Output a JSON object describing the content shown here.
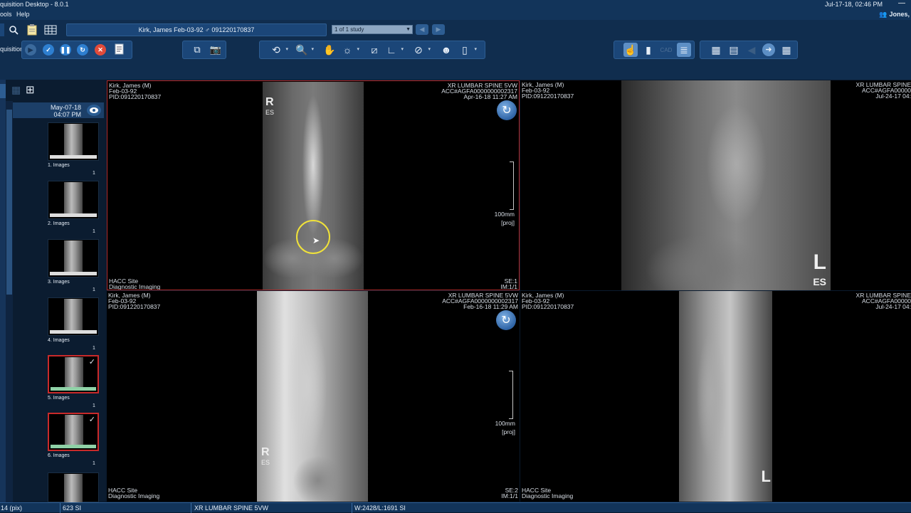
{
  "window": {
    "title": "quisition Desktop - 8.0.1",
    "datetime": "Jul-17-18, 02:46 PM",
    "user": "Jones,"
  },
  "menu": {
    "tools": "ools",
    "help": "Help"
  },
  "patient_bar": {
    "patient": "Kirk, James  Feb-03-92  ♂  091220170837",
    "study_select": "1 of 1 study"
  },
  "acquisition": {
    "label": "quisition"
  },
  "icons": {
    "search": "magnifier-icon",
    "clipboard": "clipboard-icon",
    "grid": "grid-icon",
    "play": "play-icon",
    "check": "check-icon",
    "pause": "pause-icon",
    "refresh": "refresh-icon",
    "stop": "stop-icon",
    "document": "document-icon"
  },
  "colors": {
    "accent_red": "#c92a2a",
    "panel_blue": "#1b4678",
    "thumb_green": "#8fd1a6"
  },
  "study": {
    "date": "May-07-18",
    "time": "04:07 PM"
  },
  "thumbnails": [
    {
      "label": "1.  Images",
      "count": "1",
      "selected": false
    },
    {
      "label": "2.  Images",
      "count": "1",
      "selected": false
    },
    {
      "label": "3.  Images",
      "count": "1",
      "selected": false
    },
    {
      "label": "4.  Images",
      "count": "1",
      "selected": false
    },
    {
      "label": "5.  Images",
      "count": "1",
      "selected": true
    },
    {
      "label": "6.  Images",
      "count": "1",
      "selected": true
    }
  ],
  "viewports": [
    {
      "patient": "Kirk, James (M)",
      "dob": "Feb-03-92",
      "pid": "PID:091220170837",
      "exam": "XR LUMBAR SPINE 5VW",
      "acc": "ACC#AGFA0000000002317",
      "datetime": "Apr-16-18 11:27 AM",
      "site": "HACC Site",
      "dept": "Diagnostic Imaging",
      "series": "SE:1",
      "image": "IM:1/1",
      "scale": "100mm",
      "proj": "[proj]",
      "marker": "R",
      "marker2": "ES"
    },
    {
      "patient": "Kirk, James (M)",
      "dob": "Feb-03-92",
      "pid": "PID:091220170837",
      "exam": "XR LUMBAR SPINE",
      "acc": "ACC#AGFA00000",
      "datetime": "Jul-24-17 04:",
      "marker": "L",
      "marker2": "ES"
    },
    {
      "patient": "Kirk, James (M)",
      "dob": "Feb-03-92",
      "pid": "PID:091220170837",
      "exam": "XR LUMBAR SPINE 5VW",
      "acc": "ACC#AGFA0000000002317",
      "datetime": "Feb-16-18 11:29 AM",
      "site": "HACC Site",
      "dept": "Diagnostic Imaging",
      "series": "SE:2",
      "image": "IM:1/1",
      "scale": "100mm",
      "proj": "[proj]",
      "marker": "R",
      "marker2": "ES"
    },
    {
      "patient": "Kirk, James (M)",
      "dob": "Feb-03-92",
      "pid": "PID:091220170837",
      "exam": "XR LUMBAR SPINE",
      "acc": "ACC#AGFA00000",
      "datetime": "Jul-24-17 04:",
      "site": "HACC Site",
      "dept": "Diagnostic Imaging",
      "marker": "L"
    }
  ],
  "statusbar": {
    "pix": "14 (pix)",
    "si": "623 SI",
    "exam": "XR LUMBAR SPINE 5VW",
    "wl": "W:2428/L:1691 SI"
  }
}
